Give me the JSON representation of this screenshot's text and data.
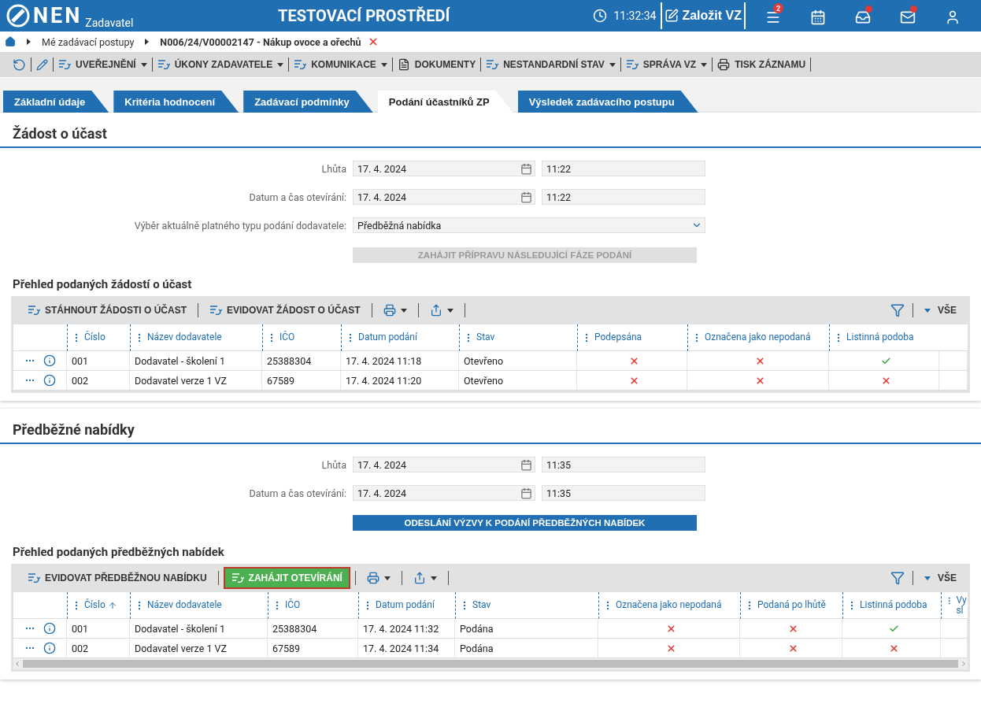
{
  "header": {
    "logo": "NEN",
    "subtitle": "Zadavatel",
    "title": "TESTOVACÍ PROSTŘEDÍ",
    "time": "11:32:34",
    "create_button": "Založit VZ",
    "icons": [
      {
        "kind": "menu",
        "badge": "2",
        "notification": false
      },
      {
        "kind": "calendar",
        "notification": false
      },
      {
        "kind": "inbox",
        "notification": true
      },
      {
        "kind": "mail",
        "notification": true
      },
      {
        "kind": "user",
        "notification": false
      }
    ]
  },
  "breadcrumb": {
    "items": [
      "Mé zadávací postupy",
      "N006/24/V00002147 - Nákup ovoce a ořechů"
    ],
    "closable": true
  },
  "toolbar": [
    {
      "label": "UVEŘEJNĚNÍ",
      "kind": "stack",
      "dropdown": true
    },
    {
      "label": "ÚKONY ZADAVATELE",
      "kind": "stack",
      "dropdown": true
    },
    {
      "label": "KOMUNIKACE",
      "kind": "stack",
      "dropdown": true
    },
    {
      "label": "DOKUMENTY",
      "kind": "document",
      "dropdown": false
    },
    {
      "label": "NESTANDARDNÍ STAV",
      "kind": "stack",
      "dropdown": true
    },
    {
      "label": "SPRÁVA VZ",
      "kind": "stack",
      "dropdown": true
    },
    {
      "label": "TISK ZÁZNAMU",
      "kind": "print",
      "dropdown": false
    }
  ],
  "tabs": [
    {
      "label": "Základní údaje",
      "selected": false
    },
    {
      "label": "Kritéria hodnocení",
      "selected": false
    },
    {
      "label": "Zadávací podmínky",
      "selected": false
    },
    {
      "label": "Podání účastníků ZP",
      "selected": true
    },
    {
      "label": "Výsledek zadávacího postupu",
      "selected": false
    }
  ],
  "sections": [
    {
      "title": "Žádost o účast",
      "fields": [
        {
          "kind": "datetime",
          "label": "Lhůta",
          "date": "17. 4. 2024",
          "time": "11:22"
        },
        {
          "kind": "datetime",
          "label": "Datum a čas otevírání:",
          "date": "17. 4. 2024",
          "time": "11:22"
        },
        {
          "kind": "select",
          "label": "Výběr aktuálně platného typu podání dodavatele:",
          "value": "Předběžná nabídka"
        }
      ],
      "action": {
        "label": "ZAHÁJIT PŘÍPRAVU NÁSLEDUJÍCÍ FÁZE PODÁNÍ",
        "disabled": true
      },
      "table": {
        "title": "Přehled podaných žádostí o účast",
        "toolbar": [
          {
            "label": "STÁHNOUT ŽÁDOSTI O ÚČAST",
            "highlighted": false
          },
          {
            "label": "EVIDOVAT ŽÁDOST O ÚČAST",
            "highlighted": false
          }
        ],
        "filter_label": "VŠE",
        "columns": [
          {
            "label": "Číslo",
            "kind": "text",
            "sorted": false
          },
          {
            "label": "Název dodavatele",
            "kind": "text",
            "sorted": false
          },
          {
            "label": "IČO",
            "kind": "text",
            "sorted": false
          },
          {
            "label": "Datum podání",
            "kind": "text",
            "sorted": false
          },
          {
            "label": "Stav",
            "kind": "text",
            "sorted": false
          },
          {
            "label": "Podepsána",
            "kind": "flag",
            "sorted": false
          },
          {
            "label": "Označena jako nepodaná",
            "kind": "flag",
            "sorted": false
          },
          {
            "label": "Listinná podoba",
            "kind": "flag",
            "sorted": false
          }
        ],
        "rows": [
          {
            "cells": [
              "001",
              "Dodavatel - školení 1",
              "25388304",
              "17. 4. 2024 11:18",
              "Otevřeno"
            ],
            "flags": [
              false,
              false,
              true
            ]
          },
          {
            "cells": [
              "002",
              "Dodavatel verze 1 VZ",
              "67589",
              "17. 4. 2024 11:20",
              "Otevřeno"
            ],
            "flags": [
              false,
              false,
              false
            ]
          }
        ],
        "scrollbar": false
      }
    },
    {
      "title": "Předběžné nabídky",
      "fields": [
        {
          "kind": "datetime",
          "label": "Lhůta",
          "date": "17. 4. 2024",
          "time": "11:35"
        },
        {
          "kind": "datetime",
          "label": "Datum a čas otevírání:",
          "date": "17. 4. 2024",
          "time": "11:35"
        }
      ],
      "action": {
        "label": "ODESLÁNÍ VÝZVY K PODÁNÍ PŘEDBĚŽNÝCH NABÍDEK",
        "disabled": false
      },
      "table": {
        "title": "Přehled podaných předběžných nabídek",
        "toolbar": [
          {
            "label": "EVIDOVAT PŘEDBĚŽNOU NABÍDKU",
            "highlighted": false
          },
          {
            "label": "ZAHÁJIT OTEVÍRÁNÍ",
            "highlighted": true
          }
        ],
        "filter_label": "VŠE",
        "columns": [
          {
            "label": "Číslo",
            "kind": "text",
            "sorted": true
          },
          {
            "label": "Název dodavatele",
            "kind": "text",
            "sorted": false
          },
          {
            "label": "IČO",
            "kind": "text",
            "sorted": false
          },
          {
            "label": "Datum podání",
            "kind": "text",
            "sorted": false
          },
          {
            "label": "Stav",
            "kind": "text",
            "sorted": false
          },
          {
            "label": "Označena jako nepodaná",
            "kind": "flag",
            "sorted": false
          },
          {
            "label": "Podaná po lhůtě",
            "kind": "flag",
            "sorted": false
          },
          {
            "label": "Listinná podoba",
            "kind": "flag",
            "sorted": false
          },
          {
            "label": "Vy sl",
            "kind": "cut",
            "sorted": false
          }
        ],
        "rows": [
          {
            "cells": [
              "001",
              "Dodavatel - školení 1",
              "25388304",
              "17. 4. 2024 11:32",
              "Podána"
            ],
            "flags": [
              false,
              false,
              true
            ]
          },
          {
            "cells": [
              "002",
              "Dodavatel verze 1 VZ",
              "67589",
              "17. 4. 2024 11:34",
              "Podána"
            ],
            "flags": [
              false,
              false,
              false
            ]
          }
        ],
        "scrollbar": true
      }
    }
  ]
}
